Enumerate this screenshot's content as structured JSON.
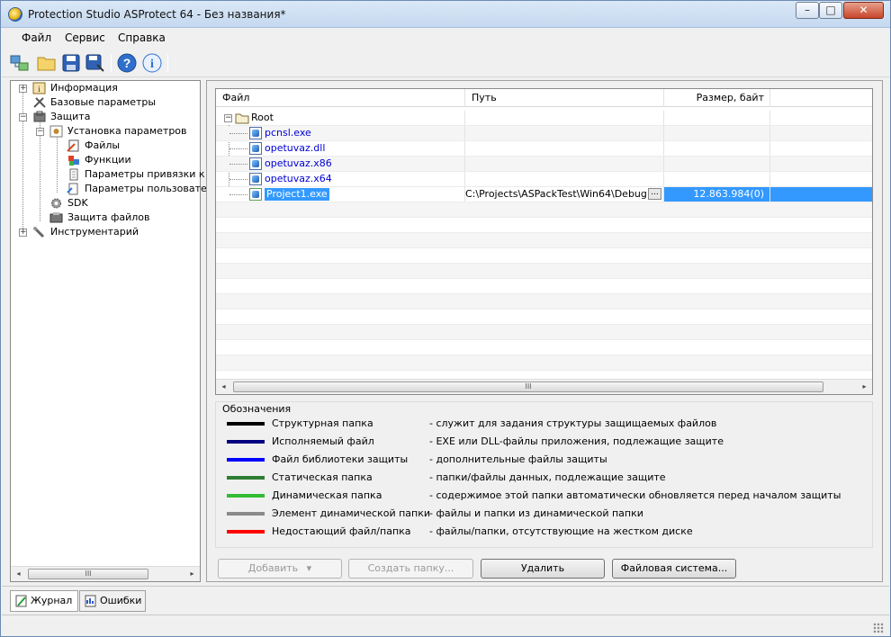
{
  "window": {
    "title": "Protection Studio ASProtect 64 - Без названия*"
  },
  "menu": [
    "Файл",
    "Сервис",
    "Справка"
  ],
  "toolbar": {
    "buttons": [
      "connect-icon",
      "open-folder-icon",
      "save-icon",
      "save-as-icon",
      "help-icon",
      "info-icon"
    ]
  },
  "tree": {
    "items": [
      {
        "label": "Информация",
        "icon": "info-icon",
        "expander": "+"
      },
      {
        "label": "Базовые параметры",
        "icon": "tools-icon",
        "expander": ""
      },
      {
        "label": "Защита",
        "icon": "shield-icon",
        "expander": "−"
      },
      {
        "label": "Установка параметров",
        "icon": "settings-icon",
        "expander": "−"
      },
      {
        "label": "Файлы",
        "icon": "files-icon",
        "expander": ""
      },
      {
        "label": "Функции",
        "icon": "functions-icon",
        "expander": ""
      },
      {
        "label": "Параметры привязки к к",
        "icon": "binding-icon",
        "expander": ""
      },
      {
        "label": "Параметры пользовател",
        "icon": "user-params-icon",
        "expander": ""
      },
      {
        "label": "SDK",
        "icon": "gear-icon",
        "expander": ""
      },
      {
        "label": "Защита файлов",
        "icon": "file-protect-icon",
        "expander": ""
      },
      {
        "label": "Инструментарий",
        "icon": "wrench-icon",
        "expander": "+"
      }
    ]
  },
  "grid": {
    "columns": [
      "Файл",
      "Путь",
      "Размер, байт"
    ],
    "root": {
      "label": "Root",
      "expander": "−"
    },
    "files": [
      {
        "name": "pcnsl.exe",
        "path": "",
        "size": ""
      },
      {
        "name": "opetuvaz.dll",
        "path": "",
        "size": ""
      },
      {
        "name": "opetuvaz.x86",
        "path": "",
        "size": ""
      },
      {
        "name": "opetuvaz.x64",
        "path": "",
        "size": ""
      },
      {
        "name": "Project1.exe",
        "path": "C:\\Projects\\ASPackTest\\Win64\\Debug",
        "size": "12.863.984(0)",
        "ellipsis": "..."
      }
    ]
  },
  "legend": {
    "title": "Обозначения",
    "items": [
      {
        "color": "#000000",
        "name": "Структурная  папка",
        "desc": "- служит для задания структуры защищаемых файлов"
      },
      {
        "color": "#000080",
        "name": "Исполняемый  файл",
        "desc": "- EXE или DLL-файлы приложения, подлежащие защите"
      },
      {
        "color": "#0000ff",
        "name": "Файл  библиотеки  защиты",
        "desc": "- дополнительные файлы защиты"
      },
      {
        "color": "#2e7d32",
        "name": "Статическая  папка",
        "desc": "- папки/файлы данных, подлежащие защите"
      },
      {
        "color": "#33bb33",
        "name": "Динамическая  папка",
        "desc": "- содержимое этой папки автоматически обновляется перед началом защиты"
      },
      {
        "color": "#8a8a8a",
        "name": "Элемент  динамической  папки",
        "desc": "  - файлы и папки из динамической папки"
      },
      {
        "color": "#ff0000",
        "name": "Недостающий  файл/папка",
        "desc": "- файлы/папки, отсутствующие на жестком диске"
      }
    ]
  },
  "buttons": {
    "add": "Добавить",
    "add_arrow": "▾",
    "create_folder": "Создать папку...",
    "delete": "Удалить",
    "filesystem": "Файловая система..."
  },
  "scroll": {
    "thumb": "III",
    "left": "◂",
    "right": "▸"
  },
  "bottom_tabs": [
    "Журнал",
    "Ошибки"
  ]
}
